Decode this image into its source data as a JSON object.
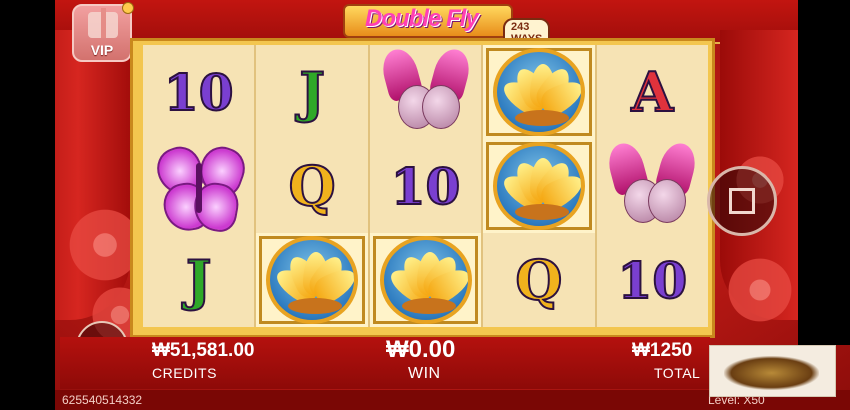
{
  "title": {
    "name": "Double Fly",
    "ways": "243 WAYS"
  },
  "vip": {
    "label": "VIP"
  },
  "reels": [
    [
      "10",
      "butterfly",
      "J"
    ],
    [
      "J",
      "Q",
      "lotus"
    ],
    [
      "mandarin-ducks",
      "10",
      "lotus"
    ],
    [
      "lotus",
      "lotus",
      "Q"
    ],
    [
      "A",
      "mandarin-ducks",
      "10"
    ]
  ],
  "credits": {
    "value": "₩51,581.00",
    "label": "CREDITS"
  },
  "win": {
    "value": "₩0.00",
    "label": "WIN"
  },
  "total": {
    "value": "₩1250",
    "label": "TOTAL"
  },
  "footer": {
    "session_id": "625540514332",
    "level_label": "Level: ",
    "level_value": "X50"
  },
  "icons": {
    "menu": "hamburger-icon",
    "stop": "stop-square-icon",
    "vip": "gift-icon"
  },
  "colors": {
    "background": "#c01b16",
    "frame": "#f3c64f",
    "reel": "#f6e3b4"
  }
}
